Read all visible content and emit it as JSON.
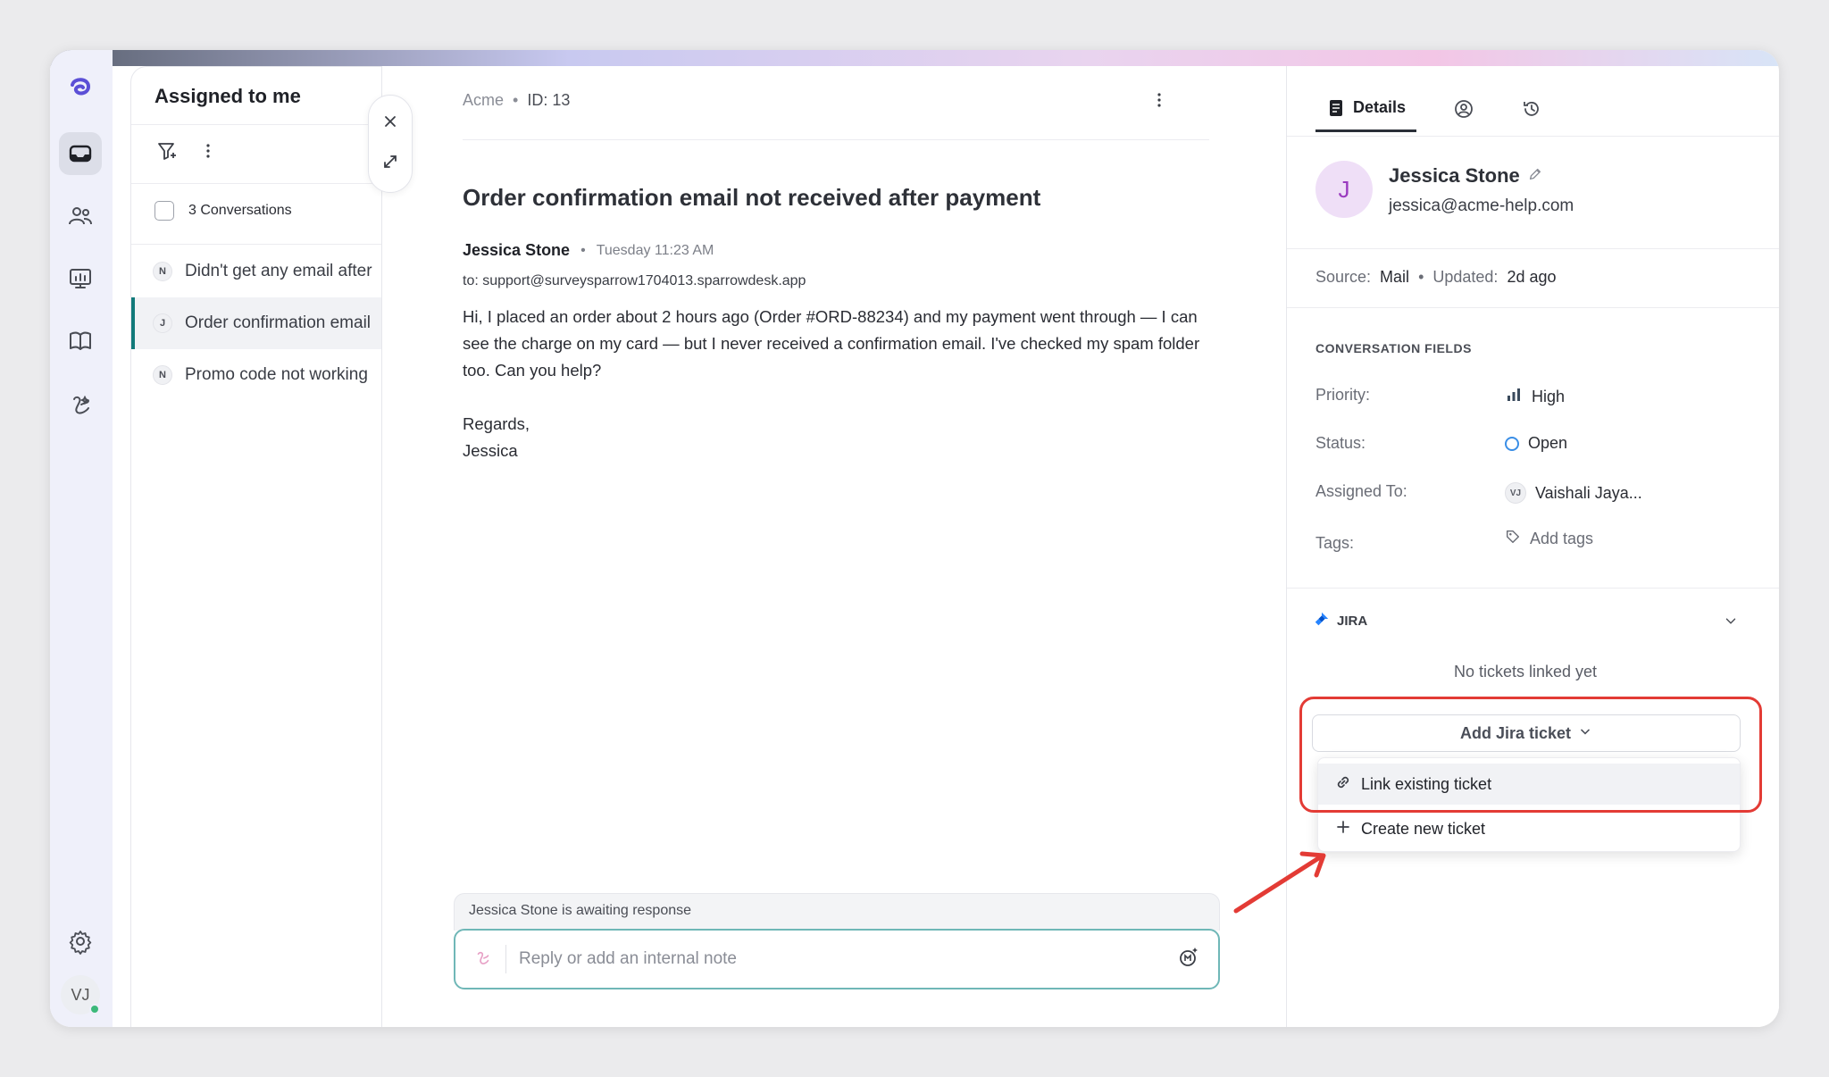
{
  "colors": {
    "accent": "#127a7a",
    "highlight": "#e33b35",
    "brand": "#5b4fd6"
  },
  "rail": {
    "icons": [
      "logo-icon",
      "inbox-icon",
      "contacts-icon",
      "reports-icon",
      "knowledge-base-icon",
      "ai-agent-icon",
      "settings-icon"
    ],
    "user_initials": "VJ"
  },
  "list": {
    "title": "Assigned to me",
    "count_label": "3 Conversations",
    "items": [
      {
        "badge": "N",
        "text": "Didn't get any email after"
      },
      {
        "badge": "J",
        "text": "Order confirmation email"
      },
      {
        "badge": "N",
        "text": "Promo code not working"
      }
    ]
  },
  "conversation": {
    "brand": "Acme",
    "id_label": "ID: 13",
    "subject": "Order confirmation email not received after payment",
    "sender": "Jessica Stone",
    "time": "Tuesday 11:23 AM",
    "to": "to: support@surveysparrow1704013.sparrowdesk.app",
    "body": [
      "Hi, I placed an order about 2 hours ago (Order #ORD-88234) and my payment went through — I can see the charge on my card — but I never received a confirmation email. I've checked my spam folder too. Can you help?",
      "Regards,",
      "Jessica"
    ],
    "awaiting": "Jessica Stone is awaiting response",
    "reply_placeholder": "Reply or add an internal note"
  },
  "details": {
    "tab_details": "Details",
    "contact": {
      "initial": "J",
      "name": "Jessica Stone",
      "email": "jessica@acme-help.com"
    },
    "source_label": "Source:",
    "source_value": "Mail",
    "updated_label": "Updated:",
    "updated_value": "2d ago",
    "section_title": "CONVERSATION FIELDS",
    "fields": {
      "priority_label": "Priority:",
      "priority_value": "High",
      "status_label": "Status:",
      "status_value": "Open",
      "assigned_label": "Assigned To:",
      "assigned_initials": "VJ",
      "assigned_value": "Vaishali Jaya...",
      "tags_label": "Tags:",
      "tags_value": "Add tags"
    },
    "jira": {
      "title": "JIRA",
      "empty": "No tickets linked yet",
      "add_button": "Add Jira ticket",
      "menu": [
        "Link existing ticket",
        "Create new ticket"
      ]
    }
  }
}
